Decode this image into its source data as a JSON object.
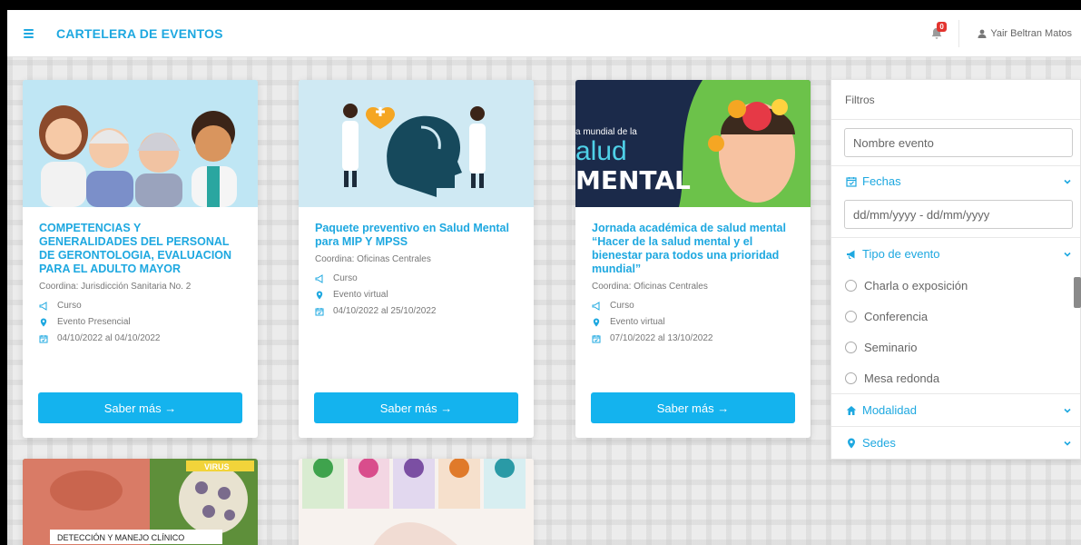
{
  "navbar": {
    "brand": "CARTELERA DE EVENTOS",
    "notification_count": "0",
    "user_name": "Yair Beltran Matos"
  },
  "colors": {
    "accent": "#1ea8e0",
    "button": "#14b3ee",
    "badge": "#e3342f"
  },
  "cards": [
    {
      "title": "COMPETENCIAS Y GENERALIDADES DEL PERSONAL DE GERONTOLOGIA, EVALUACION PARA EL ADULTO MAYOR",
      "coordina": "Coordina: Jurisdicción Sanitaria No. 2",
      "tipo": "Curso",
      "modalidad": "Evento Presencial",
      "fechas": "04/10/2022 al 04/10/2022",
      "button": "Saber más →"
    },
    {
      "title": "Paquete preventivo en Salud Mental para MIP Y MPSS",
      "coordina": "Coordina: Oficinas Centrales",
      "tipo": "Curso",
      "modalidad": "Evento virtual",
      "fechas": "04/10/2022 al 25/10/2022",
      "button": "Saber más →"
    },
    {
      "title": "Jornada académica de salud mental “Hacer de la salud mental y el bienestar para todos una prioridad mundial”",
      "coordina": "Coordina: Oficinas Centrales",
      "tipo": "Curso",
      "modalidad": "Evento virtual",
      "fechas": "07/10/2022 al 13/10/2022",
      "button": "Saber más →",
      "image_text": {
        "line1": "a mundial de la",
        "line2": "alud",
        "line3": "MENTAL"
      }
    }
  ],
  "bottom_cards": [
    {
      "image_text": {
        "virus": "VIRUS",
        "caption": "DETECCIÓN Y MANEJO CLÍNICO"
      }
    },
    {
      "image_text": {}
    }
  ],
  "filters": {
    "title": "Filtros",
    "name_placeholder": "Nombre evento",
    "fechas_label": "Fechas",
    "date_placeholder": "dd/mm/yyyy - dd/mm/yyyy",
    "tipo_label": "Tipo de evento",
    "tipo_options": [
      "Charla o exposición",
      "Conferencia",
      "Seminario",
      "Mesa redonda"
    ],
    "modalidad_label": "Modalidad",
    "sedes_label": "Sedes"
  }
}
